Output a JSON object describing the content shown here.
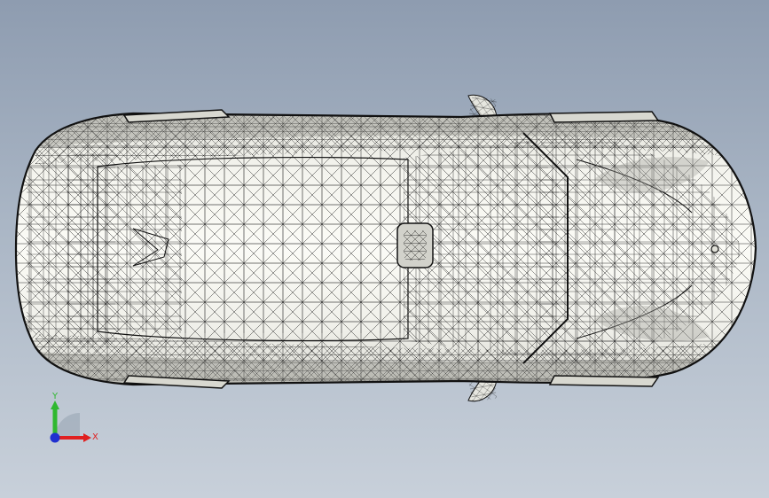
{
  "viewport": {
    "background_top": "#8e9cb0",
    "background_bottom": "#c8d0da",
    "model_fill": "#f2f2ec",
    "model_shade": "#b9b9b2",
    "edge_color": "#1a1a1a"
  },
  "axis_triad": {
    "x_label": "X",
    "y_label": "Y",
    "x_color": "#e02020",
    "y_color": "#2fb82f",
    "z_color": "#2030d0"
  }
}
